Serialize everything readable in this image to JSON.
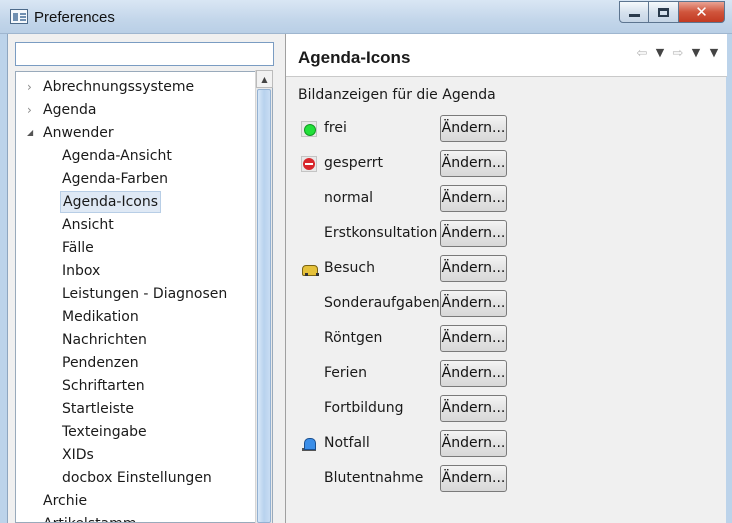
{
  "window": {
    "title": "Preferences",
    "minimize_icon": "minimize-icon",
    "maximize_icon": "maximize-icon",
    "close_icon": "close-icon",
    "close_glyph": "✕"
  },
  "filter": {
    "value": "",
    "placeholder": ""
  },
  "tree": {
    "items": [
      {
        "label": "Abrechnungssysteme",
        "level": 0,
        "expander": "collapsed"
      },
      {
        "label": "Agenda",
        "level": 0,
        "expander": "collapsed"
      },
      {
        "label": "Anwender",
        "level": 0,
        "expander": "expanded"
      },
      {
        "label": "Agenda-Ansicht",
        "level": 1
      },
      {
        "label": "Agenda-Farben",
        "level": 1
      },
      {
        "label": "Agenda-Icons",
        "level": 1,
        "selected": true
      },
      {
        "label": "Ansicht",
        "level": 1
      },
      {
        "label": "Fälle",
        "level": 1
      },
      {
        "label": "Inbox",
        "level": 1
      },
      {
        "label": "Leistungen - Diagnosen",
        "level": 1
      },
      {
        "label": "Medikation",
        "level": 1
      },
      {
        "label": "Nachrichten",
        "level": 1
      },
      {
        "label": "Pendenzen",
        "level": 1
      },
      {
        "label": "Schriftarten",
        "level": 1
      },
      {
        "label": "Startleiste",
        "level": 1
      },
      {
        "label": "Texteingabe",
        "level": 1
      },
      {
        "label": "XIDs",
        "level": 1
      },
      {
        "label": "docbox Einstellungen",
        "level": 1
      },
      {
        "label": "Archie",
        "level": 0
      },
      {
        "label": "Artikelstamm",
        "level": 0
      }
    ]
  },
  "page": {
    "title": "Agenda-Icons",
    "section_label": "Bildanzeigen für die Agenda",
    "nav": {
      "back_icon": "back-arrow-icon",
      "forward_icon": "forward-arrow-icon",
      "menu_icon": "view-menu-icon"
    },
    "button_label": "Ändern...",
    "rows": [
      {
        "name": "frei",
        "icon": "green-dot-icon"
      },
      {
        "name": "gesperrt",
        "icon": "no-entry-icon"
      },
      {
        "name": "normal",
        "icon": ""
      },
      {
        "name": "Erstkonsultation",
        "icon": ""
      },
      {
        "name": "Besuch",
        "icon": "car-icon"
      },
      {
        "name": "Sonderaufgaben",
        "icon": ""
      },
      {
        "name": "Röntgen",
        "icon": ""
      },
      {
        "name": "Ferien",
        "icon": ""
      },
      {
        "name": "Fortbildung",
        "icon": ""
      },
      {
        "name": "Notfall",
        "icon": "siren-icon"
      },
      {
        "name": "Blutentnahme",
        "icon": ""
      }
    ]
  },
  "colors": {
    "title_bar": "#c3d6ea",
    "selection": "#dfe9f5",
    "close_button": "#d0553c"
  }
}
